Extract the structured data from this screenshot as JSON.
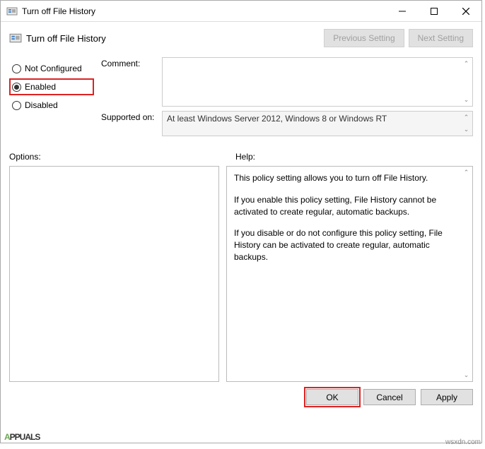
{
  "window": {
    "title": "Turn off File History"
  },
  "header": {
    "title": "Turn off File History",
    "prev_button": "Previous Setting",
    "next_button": "Next Setting"
  },
  "radios": {
    "not_configured": "Not Configured",
    "enabled": "Enabled",
    "disabled": "Disabled",
    "selected": "enabled"
  },
  "fields": {
    "comment_label": "Comment:",
    "comment_value": "",
    "supported_label": "Supported on:",
    "supported_value": "At least Windows Server 2012, Windows 8 or Windows RT"
  },
  "labels": {
    "options": "Options:",
    "help": "Help:"
  },
  "help": {
    "p1": "This policy setting allows you to turn off File History.",
    "p2": "If you enable this policy setting, File History cannot be activated to create regular, automatic backups.",
    "p3": "If you disable or do not configure this policy setting, File History can be activated to create regular, automatic backups."
  },
  "footer": {
    "ok": "OK",
    "cancel": "Cancel",
    "apply": "Apply"
  },
  "watermark": {
    "brand_part1": "A",
    "brand_part2": "PPUALS",
    "site": "wsxdn.com"
  }
}
